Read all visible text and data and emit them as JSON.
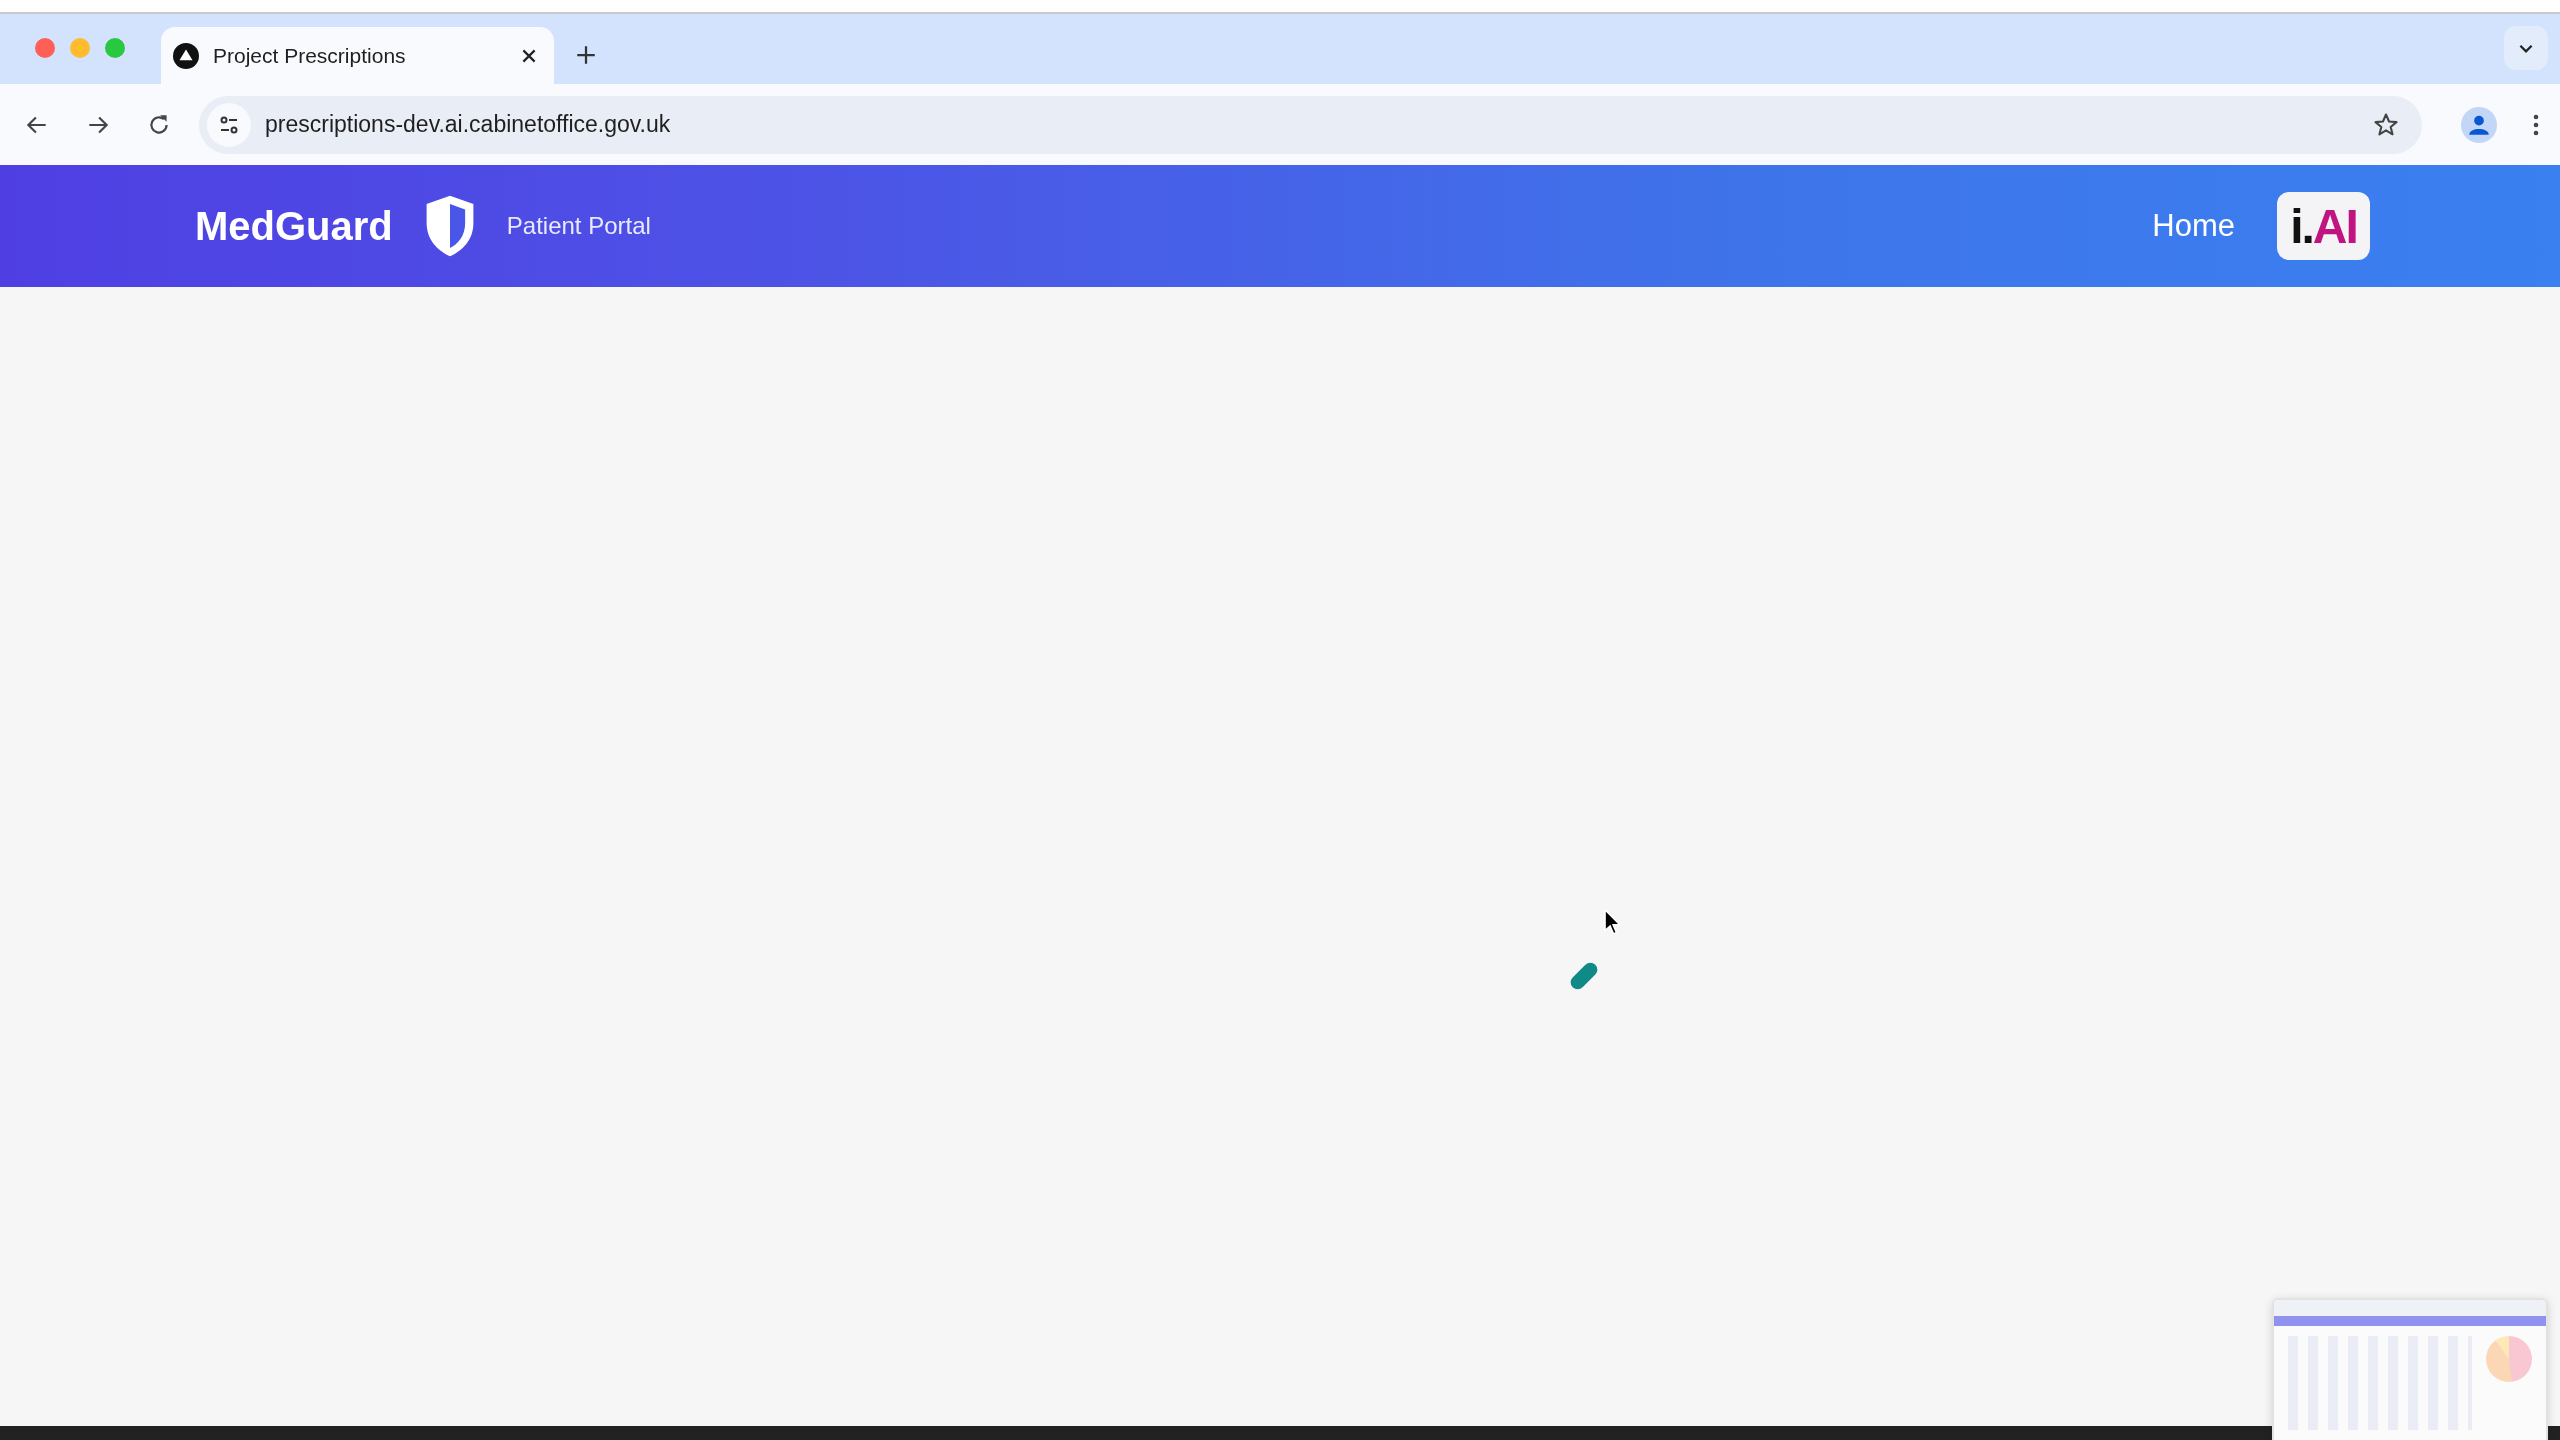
{
  "browser": {
    "tabs": [
      {
        "title": "Project Prescriptions",
        "selected": true
      }
    ],
    "address": "prescriptions-dev.ai.cabinetoffice.gov.uk"
  },
  "header": {
    "brand": "MedGuard",
    "subtitle": "Patient Portal",
    "nav": [
      "Home"
    ],
    "logo_parts": [
      "i.",
      "AI"
    ]
  }
}
